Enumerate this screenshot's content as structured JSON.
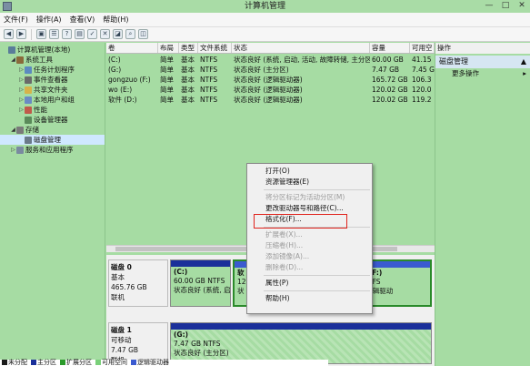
{
  "window": {
    "title": "计算机管理",
    "btn_min": "—",
    "btn_max": "□",
    "btn_close": "✕"
  },
  "menu": [
    "文件(F)",
    "操作(A)",
    "查看(V)",
    "帮助(H)"
  ],
  "toolbar_icons": [
    "back-icon",
    "forward-icon",
    "folder-icon",
    "list-icon",
    "help-icon",
    "properties-icon",
    "check-icon",
    "delete-icon",
    "open-icon",
    "search-icon",
    "zoom-icon"
  ],
  "tree": [
    {
      "label": "计算机管理(本地)",
      "depth": 0,
      "exp": "",
      "color": "#5a7d9a"
    },
    {
      "label": "系统工具",
      "depth": 1,
      "exp": "◢",
      "color": "#8a6a3a"
    },
    {
      "label": "任务计划程序",
      "depth": 2,
      "exp": "▷",
      "color": "#5c8ac0"
    },
    {
      "label": "事件查看器",
      "depth": 2,
      "exp": "▷",
      "color": "#6a6a6a"
    },
    {
      "label": "共享文件夹",
      "depth": 2,
      "exp": "▷",
      "color": "#d6b24a"
    },
    {
      "label": "本地用户和组",
      "depth": 2,
      "exp": "▷",
      "color": "#6a8ac4"
    },
    {
      "label": "性能",
      "depth": 2,
      "exp": "▷",
      "color": "#c05a4a"
    },
    {
      "label": "设备管理器",
      "depth": 2,
      "exp": "",
      "color": "#5a8a5a"
    },
    {
      "label": "存储",
      "depth": 1,
      "exp": "◢",
      "color": "#7a7a7a"
    },
    {
      "label": "磁盘管理",
      "depth": 2,
      "exp": "",
      "color": "#6a7a8a",
      "sel": true
    },
    {
      "label": "服务和应用程序",
      "depth": 1,
      "exp": "▷",
      "color": "#7a8aa0"
    }
  ],
  "columns": [
    "卷",
    "布局",
    "类型",
    "文件系统",
    "状态",
    "容量",
    "可用空"
  ],
  "volumes": [
    [
      "(C:)",
      "简单",
      "基本",
      "NTFS",
      "状态良好 (系统, 启动, 活动, 故障转储, 主分区)",
      "60.00 GB",
      "41.15"
    ],
    [
      "(G:)",
      "简单",
      "基本",
      "NTFS",
      "状态良好 (主分区)",
      "7.47 GB",
      "7.45 G"
    ],
    [
      "gongzuo (F:)",
      "简单",
      "基本",
      "NTFS",
      "状态良好 (逻辑驱动器)",
      "165.72 GB",
      "106.3"
    ],
    [
      "wo (E:)",
      "简单",
      "基本",
      "NTFS",
      "状态良好 (逻辑驱动器)",
      "120.02 GB",
      "120.0"
    ],
    [
      "软件 (D:)",
      "简单",
      "基本",
      "NTFS",
      "状态良好 (逻辑驱动器)",
      "120.02 GB",
      "119.2"
    ]
  ],
  "disk0": {
    "name": "磁盘 0",
    "type": "基本",
    "size": "465.76 GB",
    "status": "联机"
  },
  "disk1": {
    "name": "磁盘 1",
    "type": "可移动",
    "size": "7.47 GB",
    "status": "联机"
  },
  "part_c": {
    "name": "(C:)",
    "size": "60.00 GB NTFS",
    "status": "状态良好 (系统, 启"
  },
  "part_d": {
    "name": "软",
    "size": "120",
    "status": "状"
  },
  "part_f": {
    "name": "gongzuo  (F:)",
    "size": "5.72 GB NTFS",
    "status": "状态良好 (逻辑驱动"
  },
  "part_g": {
    "name": "(G:)",
    "size": "7.47 GB NTFS",
    "status": "状态良好 (主分区)"
  },
  "legend": [
    {
      "label": "未分配",
      "color": "#1a1a1a"
    },
    {
      "label": "主分区",
      "color": "#1a2f9a"
    },
    {
      "label": "扩展分区",
      "color": "#2a9a2a"
    },
    {
      "label": "可用空间",
      "color": "#7ad07a"
    },
    {
      "label": "逻辑驱动器",
      "color": "#3a5ad0"
    }
  ],
  "actions": {
    "title": "操作",
    "section": "磁盘管理",
    "more": "更多操作",
    "arrow_up": "▲",
    "arrow_right": "▸"
  },
  "context_menu": {
    "group1": [
      {
        "label": "打开(O)",
        "dis": false
      },
      {
        "label": "资源管理器(E)",
        "dis": false
      }
    ],
    "group2": [
      {
        "label": "将分区标记为活动分区(M)",
        "dis": true
      },
      {
        "label": "更改驱动器号和路径(C)...",
        "dis": false
      },
      {
        "label": "格式化(F)...",
        "dis": false
      }
    ],
    "group3": [
      {
        "label": "扩展卷(X)...",
        "dis": true
      },
      {
        "label": "压缩卷(H)...",
        "dis": true
      },
      {
        "label": "添加镜像(A)...",
        "dis": true
      },
      {
        "label": "删除卷(D)...",
        "dis": true
      }
    ],
    "group4": [
      {
        "label": "属性(P)",
        "dis": false
      }
    ],
    "group5": [
      {
        "label": "帮助(H)",
        "dis": false
      }
    ]
  }
}
